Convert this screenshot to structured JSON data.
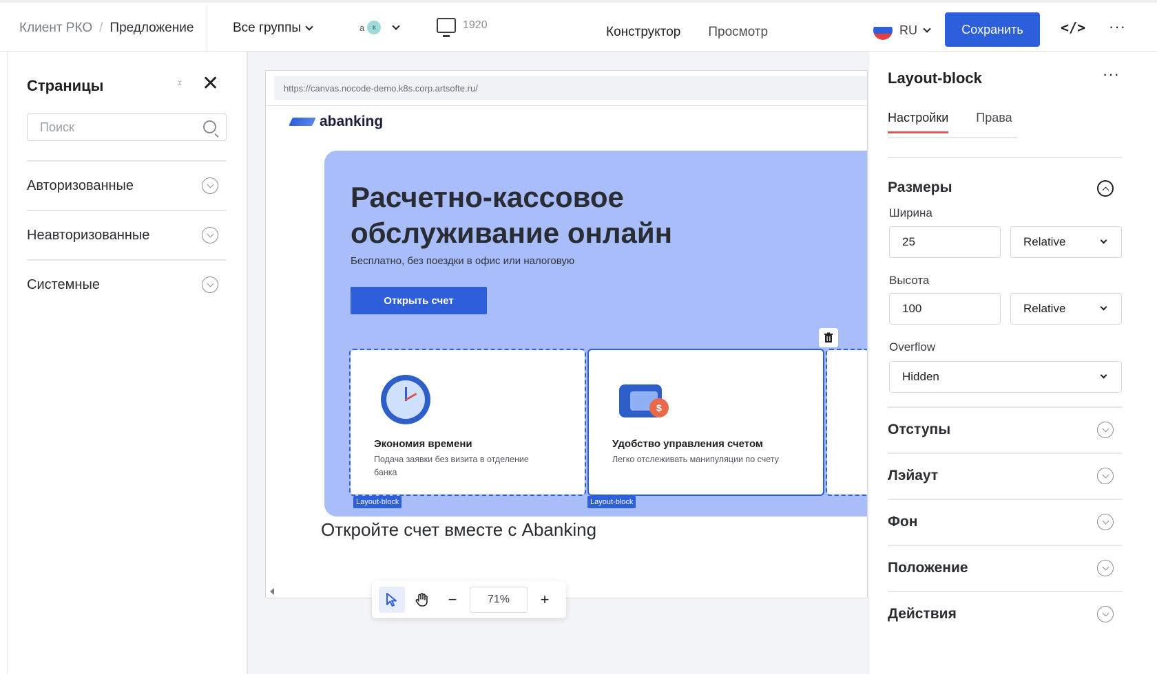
{
  "breadcrumb": {
    "root": "Клиент РКО",
    "separator": "/",
    "current": "Предложение"
  },
  "header": {
    "groups_label": "Все группы",
    "lang_prefix": "а",
    "lang_badge": "к",
    "device_width": "1920",
    "tabs": [
      {
        "label": "Конструктор",
        "active": true
      },
      {
        "label": "Просмотр",
        "active": false
      }
    ],
    "locale": "RU",
    "save_label": "Сохранить",
    "code_label": "</>",
    "more_label": "···"
  },
  "pages_panel": {
    "title": "Страницы",
    "close_label": "✕",
    "search_placeholder": "Поиск",
    "items": [
      {
        "label": "Авторизованные"
      },
      {
        "label": "Неавторизованные"
      },
      {
        "label": "Системные"
      }
    ]
  },
  "canvas": {
    "url": "https://canvas.nocode-demo.k8s.corp.artsofte.ru/",
    "logo_text": "abanking",
    "hero_title": "Расчетно-кассовое обслуживание онлайн",
    "hero_subtitle": "Бесплатно, без поездки в офис или налоговую",
    "hero_button": "Открыть счет",
    "cards": [
      {
        "title": "Экономия времени",
        "desc": "Подача заявки без визита в отделение банка",
        "tag": "Layout-block"
      },
      {
        "title": "Удобство управления счетом",
        "desc": "Легко отслеживать манипуляции по счету",
        "tag": "Layout-block"
      }
    ],
    "wallet_badge": "$",
    "next_title": "Откройте счет вместе с Abanking"
  },
  "toolbar": {
    "zoom": "71%",
    "minus": "−",
    "plus": "+"
  },
  "properties_panel": {
    "title": "Layout-block",
    "more_label": "···",
    "tabs": [
      {
        "label": "Настройки",
        "active": true
      },
      {
        "label": "Права",
        "active": false
      }
    ],
    "sizes": {
      "title": "Размеры",
      "width_label": "Ширина",
      "width_value": "25",
      "width_unit": "Relative",
      "height_label": "Высота",
      "height_value": "100",
      "height_unit": "Relative",
      "overflow_label": "Overflow",
      "overflow_value": "Hidden"
    },
    "sections": [
      "Отступы",
      "Лэйаут",
      "Фон",
      "Положение",
      "Действия"
    ]
  },
  "colors": {
    "accent": "#2c5fd9",
    "active_tab_underline": "#e45757",
    "hero_bg": "#a9bdfa"
  }
}
